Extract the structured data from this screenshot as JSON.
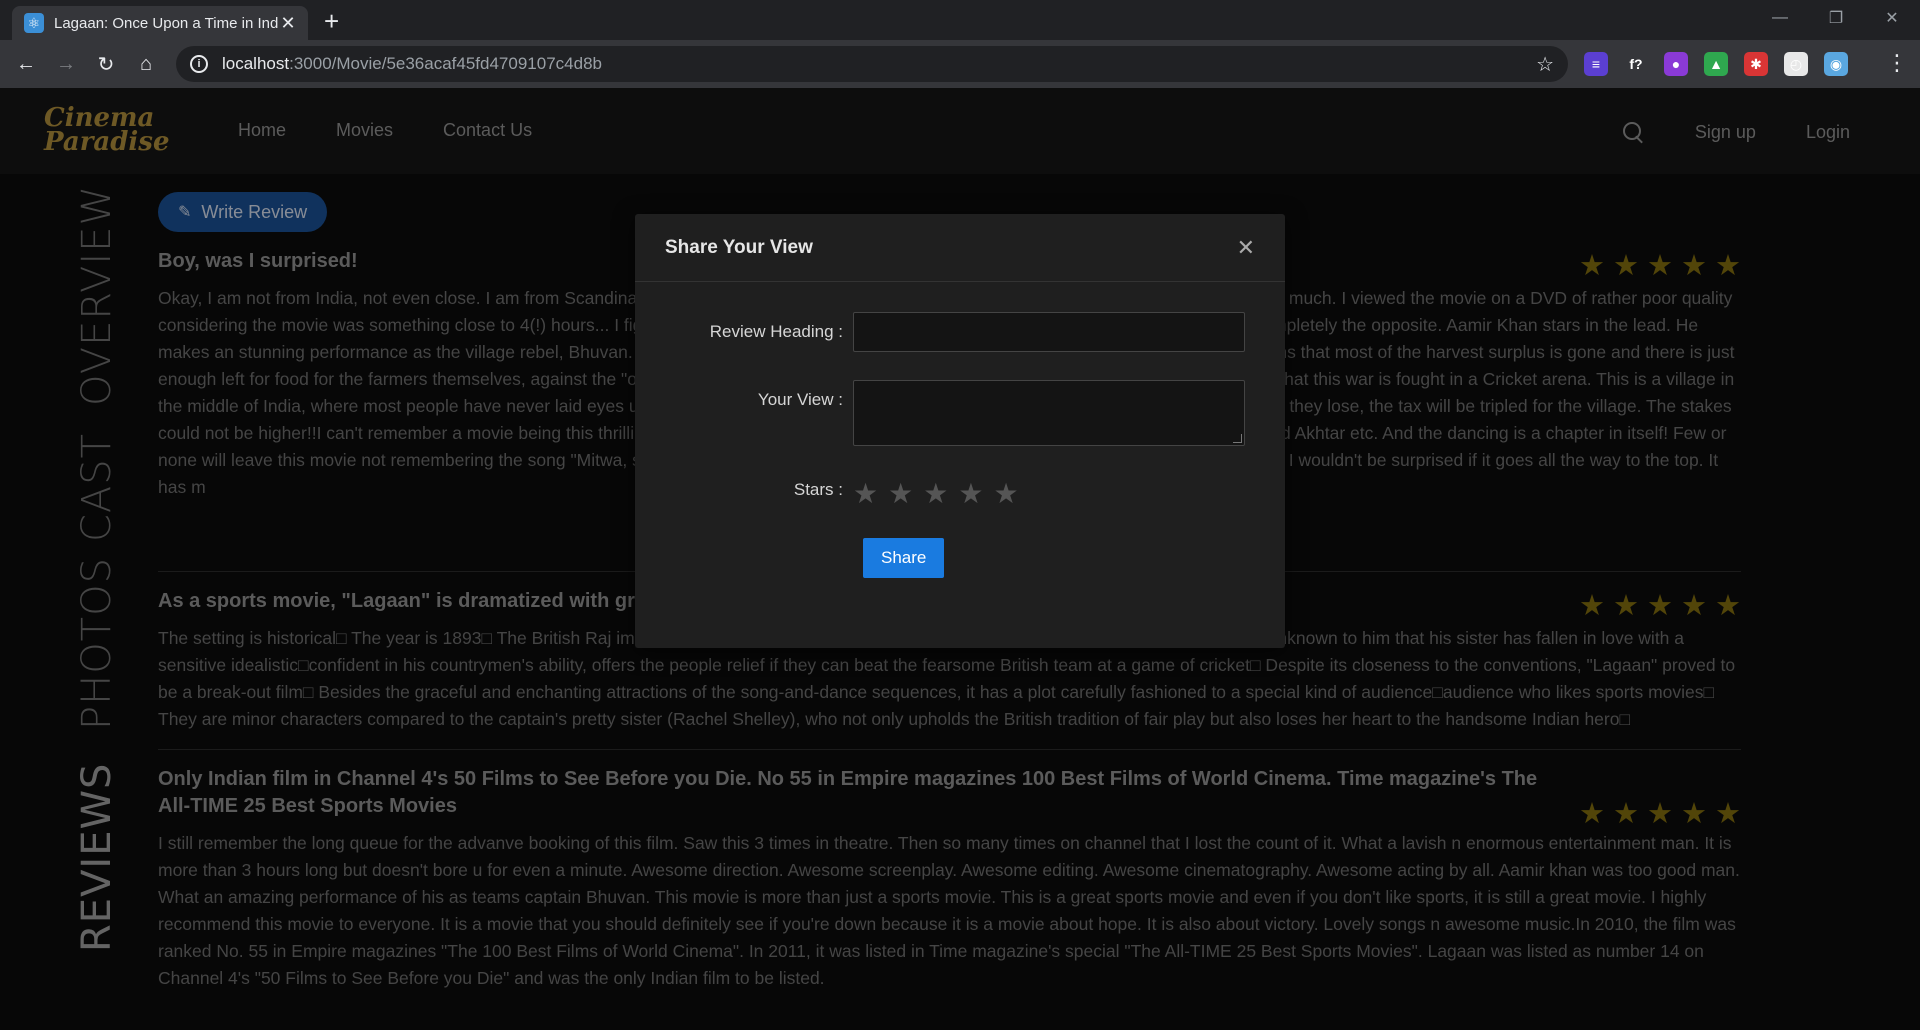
{
  "browser": {
    "tab_title": "Lagaan: Once Upon a Time in Ind",
    "tab_favicon": "⚛",
    "new_tab": "+",
    "url_host": "localhost",
    "url_path": ":3000/Movie/5e36acaf45fd4709107c4d8b",
    "minimize": "—",
    "maximize": "❐",
    "close": "✕",
    "back": "←",
    "forward": "→",
    "reload": "↻",
    "home": "⌂",
    "star": "☆",
    "menu": "⋮",
    "extensions": [
      {
        "name": "stack-extension-icon",
        "glyph": "≡",
        "color": "#5b3fd1"
      },
      {
        "name": "font-extension-icon",
        "glyph": "f?",
        "color": "#35363a"
      },
      {
        "name": "chat-extension-icon",
        "glyph": "●",
        "color": "#8a3ad6"
      },
      {
        "name": "drive-extension-icon",
        "glyph": "▲",
        "color": "#2fa84f"
      },
      {
        "name": "bug-extension-icon",
        "glyph": "✱",
        "color": "#d93535"
      },
      {
        "name": "clock-extension-icon",
        "glyph": "◴",
        "color": "#e8e8e8"
      },
      {
        "name": "profile-avatar-icon",
        "glyph": "◉",
        "color": "#5aa7e0"
      }
    ]
  },
  "site": {
    "logo_line1": "Cinema",
    "logo_line2": "Paradise",
    "nav": [
      "Home",
      "Movies",
      "Contact Us"
    ],
    "signup": "Sign up",
    "login": "Login"
  },
  "side_tabs": [
    "OVERVIEW",
    "CAST",
    "PHOTOS",
    "REVIEWS"
  ],
  "reviews": {
    "write_label": "Write Review",
    "items": [
      {
        "title": "Boy, was I surprised!",
        "stars": 5,
        "body": "Okay, I am not from India, not even close. I am from Scandinavia, and I don't understand a word from the hindi language. And I don't like musicals much. I viewed the movie on a DVD of rather poor quality considering the movie was something close to 4(!) hours... I figured this would be a complete waste of time... BOY was I wrong! This movie is completely the opposite. Aamir Khan stars in the lead. He makes an stunning performance as the village rebel, Bhuvan. He tries to unite the village in a struggle against a tax called lagaan (tax). This means that most of the harvest surplus is gone and there is just enough left for food for the farmers themselves, against the \"oppressors\", the powerful and greedy Britons. But what makes it really interesting is that this war is fought in a Cricket arena. This is a village in the middle of India, where most people have never laid eyes upon a cricket bat. If the villagers win, there will be no lagaan at all, for three years! If they lose, the tax will be tripled for the village. The stakes could not be higher!!I can't remember a movie being this thrilling and having so much life in it. And the music is composed by A. R. Rahman, Javed Akhtar etc. And the dancing is a chapter in itself! Few or none will leave this movie not remembering the song \"Mitwa, sun Mitwa\". This movie has been totally righteously nominated for an Oscar too, and I wouldn't be surprised if it goes all the way to the top. It has m"
      },
      {
        "title": "As a sports movie, \"Lagaan\" is dramatized with grea",
        "stars": 5,
        "body": "The setting is historical□ The year is 1893□ The British Raj imposes a heavy tax on villagers based on their income□ An arrogant army captain□unknown to him that his sister has fallen in love with a sensitive idealistic□confident in his countrymen's ability, offers the people relief if they can beat the fearsome British team at a game of cricket□ Despite its closeness to the conventions, \"Lagaan\" proved to be a break-out film□ Besides the graceful and enchanting attractions of the song-and-dance sequences, it has a plot carefully fashioned to a special kind of audience□audience who likes sports movies□ They are minor characters compared to the captain's pretty sister (Rachel Shelley), who not only upholds the British tradition of fair play but also loses her heart to the handsome Indian hero□"
      },
      {
        "title": "Only Indian film in Channel 4's 50 Films to See Before you Die. No 55 in Empire magazines 100 Best Films of World Cinema. Time magazine's The All-TIME 25 Best Sports Movies",
        "stars": 5,
        "body": "I still remember the long queue for the advanve booking of this film. Saw this 3 times in theatre. Then so many times on channel that I lost the count of it. What a lavish n enormous entertainment man. It is more than 3 hours long but doesn't bore u for even a minute. Awesome direction. Awesome screenplay. Awesome editing. Awesome cinematography. Awesome acting by all. Aamir khan was too good man. What an amazing performance of his as teams captain Bhuvan. This movie is more than just a sports movie. This is a great sports movie and even if you don't like sports, it is still a great movie. I highly recommend this movie to everyone. It is a movie that you should definitely see if you're down because it is a movie about hope. It is also about victory. Lovely songs n awesome music.In 2010, the film was ranked No. 55 in Empire magazines \"The 100 Best Films of World Cinema\". In 2011, it was listed in Time magazine's special \"The All-TIME 25 Best Sports Movies\". Lagaan was listed as number 14 on Channel 4's \"50 Films to See Before you Die\" and was the only Indian film to be listed."
      }
    ]
  },
  "modal": {
    "title": "Share Your View",
    "close": "✕",
    "heading_label": "Review Heading",
    "view_label": "Your View",
    "stars_label": "Stars",
    "heading_value": "",
    "view_value": "",
    "star_glyph": "★",
    "share_label": "Share"
  },
  "colors": {
    "accent": "#1a7be0",
    "star_gold": "#7f6a0f",
    "logo": "#a9893a"
  }
}
